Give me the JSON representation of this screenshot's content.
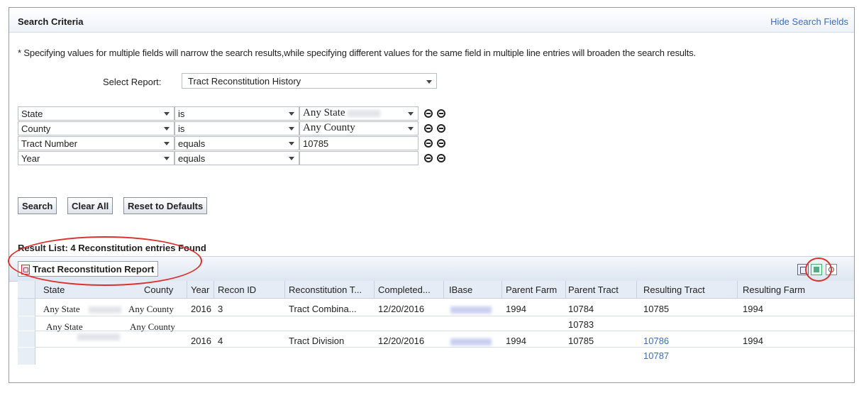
{
  "criteria": {
    "title": "Search Criteria",
    "hide_link": "Hide Search Fields",
    "note": "* Specifying values for multiple fields will narrow the search results,while specifying different values for the same field in multiple line entries will broaden the search results.",
    "select_report_label": "Select Report:",
    "select_report_value": "Tract Reconstitution History",
    "rows": [
      {
        "field": "State",
        "operator": "is",
        "value": "Any State"
      },
      {
        "field": "County",
        "operator": "is",
        "value": "Any County"
      },
      {
        "field": "Tract Number",
        "operator": "equals",
        "value": "10785"
      },
      {
        "field": "Year",
        "operator": "equals",
        "value": ""
      }
    ],
    "buttons": {
      "search": "Search",
      "clear_all": "Clear All",
      "reset": "Reset to Defaults"
    }
  },
  "results": {
    "title": "Result List: 4 Reconstitution entries Found",
    "report_button": "Tract Reconstitution Report",
    "columns": [
      "State",
      "County",
      "Year",
      "Recon ID",
      "Reconstitution T...",
      "Completed...",
      "IBase",
      "Parent Farm",
      "Parent Tract",
      "Resulting Tract",
      "Resulting Farm"
    ],
    "rows": [
      {
        "state": "Any State",
        "county": "Any County",
        "year": "2016",
        "recon_id": "3",
        "type": "Tract Combina...",
        "completed": "12/20/2016",
        "parent_farm": "1994",
        "parent_tract": "10784",
        "resulting_tract": "10785",
        "resulting_farm": "1994"
      },
      {
        "parent_tract": "10783"
      },
      {
        "state": "Any State",
        "county": "Any County",
        "year": "2016",
        "recon_id": "4",
        "type": "Tract Division",
        "completed": "12/20/2016",
        "parent_farm": "1994",
        "parent_tract": "10785",
        "resulting_tract": "10786",
        "resulting_farm": "1994"
      },
      {
        "resulting_tract": "10787"
      }
    ]
  },
  "colors": {
    "accent_link": "#3b6fb6",
    "annotation": "#d9322e",
    "header_bg": "#e5ecf5"
  }
}
